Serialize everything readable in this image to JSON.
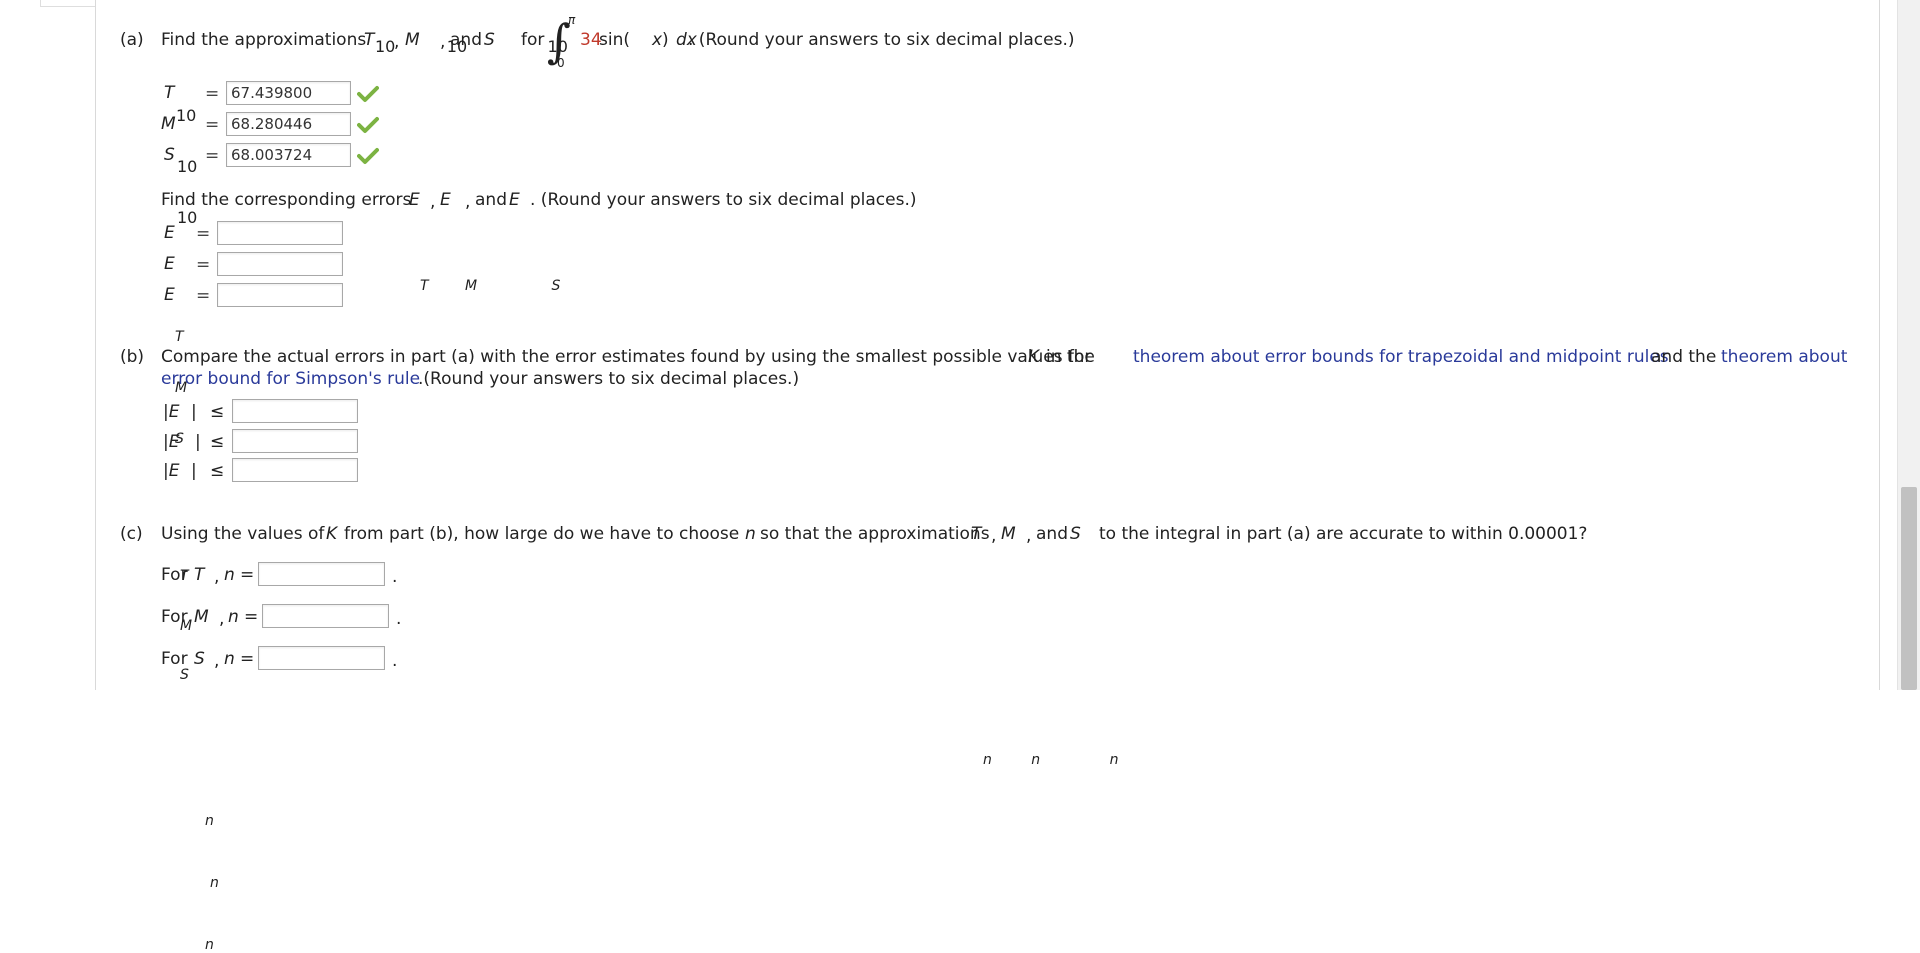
{
  "part_a": {
    "marker": "(a)",
    "prompt_pre": "Find the approximations",
    "t_sym": "T",
    "m_sym": "M",
    "s_sym": "S",
    "n10": "10",
    "comma": ",",
    "and": "and",
    "for": "for",
    "upper_limit": "π",
    "lower_limit": "0",
    "integrand_coef": "34",
    "integrand_fn": " sin(",
    "x_var": "x",
    "close_paren": ")",
    "dx": "dx",
    "prompt_post": ". (Round your answers to six decimal places.)",
    "answers": [
      {
        "label": "T",
        "sub": "10",
        "value": "67.439800"
      },
      {
        "label": "M",
        "sub": "10",
        "value": "68.280446"
      },
      {
        "label": "S",
        "sub": "10",
        "value": "68.003724"
      }
    ],
    "errors_prompt_pre": "Find the corresponding errors",
    "e_sym": "E",
    "sub_t": "T",
    "sub_m": "M",
    "sub_s": "S",
    "errors_prompt_post": ". (Round your answers to six decimal places.)",
    "error_rows": [
      {
        "label": "E",
        "sub": "T",
        "value": ""
      },
      {
        "label": "E",
        "sub": "M",
        "value": ""
      },
      {
        "label": "E",
        "sub": "S",
        "value": ""
      }
    ],
    "equals": "="
  },
  "part_b": {
    "marker": "(b)",
    "line1_pre": "Compare the actual errors in part (a) with the error estimates found by using the smallest possible values for",
    "k": "K",
    "line1_mid": "in the",
    "link1": "theorem about error bounds for trapezoidal and midpoint rules",
    "and": "and the",
    "link2a": "theorem about",
    "link2b": "error bound for Simpson's rule",
    "line2_post": ".(Round your answers to six decimal places.)",
    "rows": [
      {
        "label": "|E",
        "sub": "T",
        "close": "|",
        "op": "≤",
        "value": ""
      },
      {
        "label": "|E",
        "sub": "M",
        "close": "|",
        "op": "≤",
        "value": ""
      },
      {
        "label": "|E",
        "sub": "S",
        "close": "|",
        "op": "≤",
        "value": ""
      }
    ]
  },
  "part_c": {
    "marker": "(c)",
    "prompt_pre": "Using the values of",
    "k": "K",
    "prompt_mid": "from part (b), how large do we have to choose",
    "n": "n",
    "prompt_mid2": "so that the approximations",
    "prompt_and": "and",
    "prompt_post": "to the integral in part (a) are accurate to within 0.00001?",
    "rows": [
      {
        "pre": "For",
        "sym": "T",
        "sub": "n",
        "comma": ",",
        "n": "n",
        "eq": "=",
        "value": "",
        "dot": "."
      },
      {
        "pre": "For",
        "sym": "M",
        "sub": "n",
        "comma": ",",
        "n": "n",
        "eq": "=",
        "value": "",
        "dot": "."
      },
      {
        "pre": "For",
        "sym": "S",
        "sub": "n",
        "comma": ",",
        "n": "n",
        "eq": "=",
        "value": "",
        "dot": "."
      }
    ]
  },
  "colors": {
    "check": "#7cb342",
    "link": "#2a3a9a",
    "highlight": "#c0392b"
  }
}
